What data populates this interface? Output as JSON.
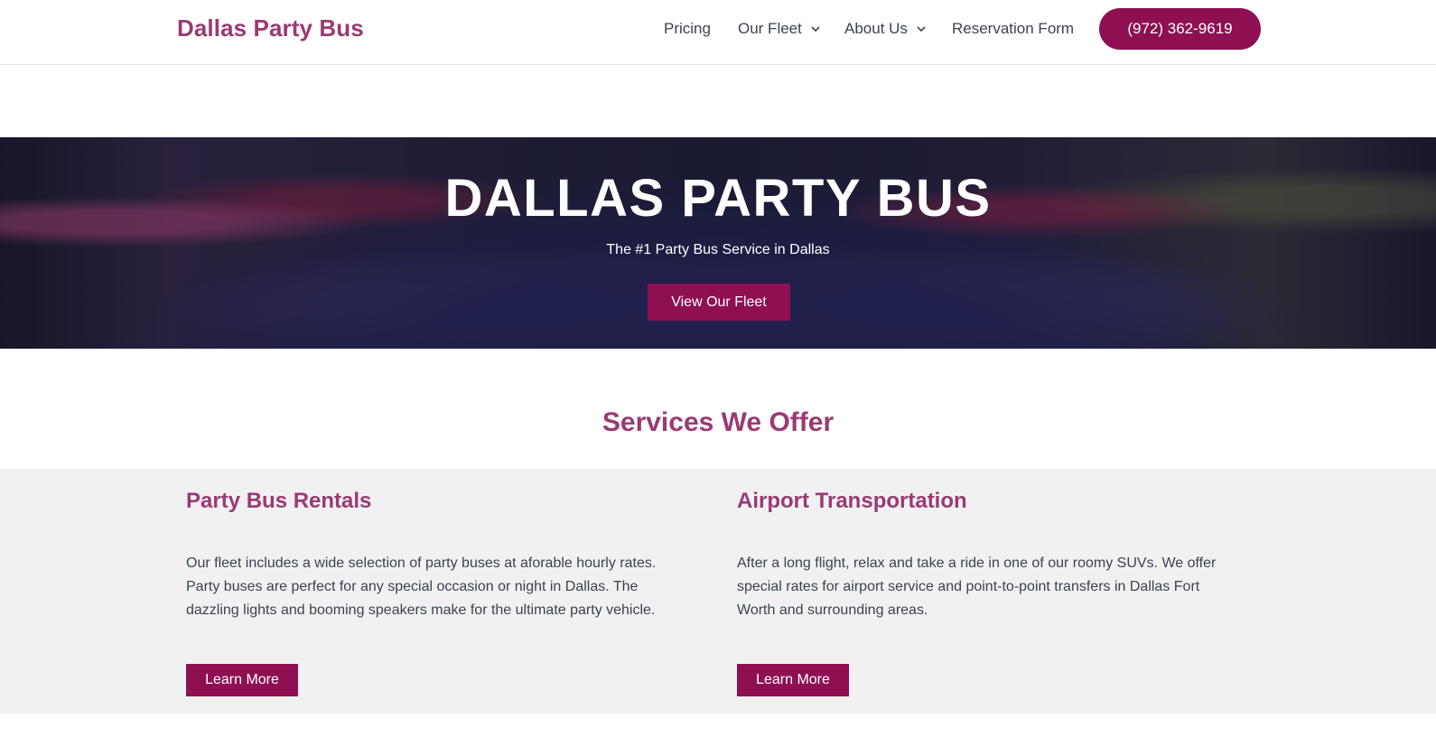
{
  "header": {
    "brand": "Dallas Party Bus",
    "nav": [
      {
        "label": "Pricing",
        "has_dropdown": false
      },
      {
        "label": "Our Fleet",
        "has_dropdown": true
      },
      {
        "label": "About Us",
        "has_dropdown": true
      },
      {
        "label": "Reservation Form",
        "has_dropdown": false
      }
    ],
    "phone": "(972) 362-9619"
  },
  "hero": {
    "title": "DALLAS PARTY BUS",
    "subtitle": "The #1 Party Bus Service in Dallas",
    "cta": "View Our Fleet"
  },
  "services": {
    "heading": "Services We Offer",
    "items": [
      {
        "title": "Party Bus Rentals",
        "text": "Our fleet includes a wide selection of party buses at aforable hourly rates. Party buses are perfect for any special occasion or night in Dallas. The dazzling lights and booming speakers make for the ultimate party vehicle.",
        "button": "Learn More"
      },
      {
        "title": "Airport Transportation",
        "text": "After a long flight, relax and take a ride in one of our roomy SUVs. We offer special rates for airport service and point-to-point transfers in Dallas Fort Worth and surrounding areas.",
        "button": "Learn More"
      }
    ]
  },
  "colors": {
    "brand": "#9a3a72",
    "button": "#8e1052",
    "section_bg": "#f1f1f1",
    "text": "#3b4350"
  },
  "icons": {
    "dropdown": "chevron-down-icon"
  }
}
